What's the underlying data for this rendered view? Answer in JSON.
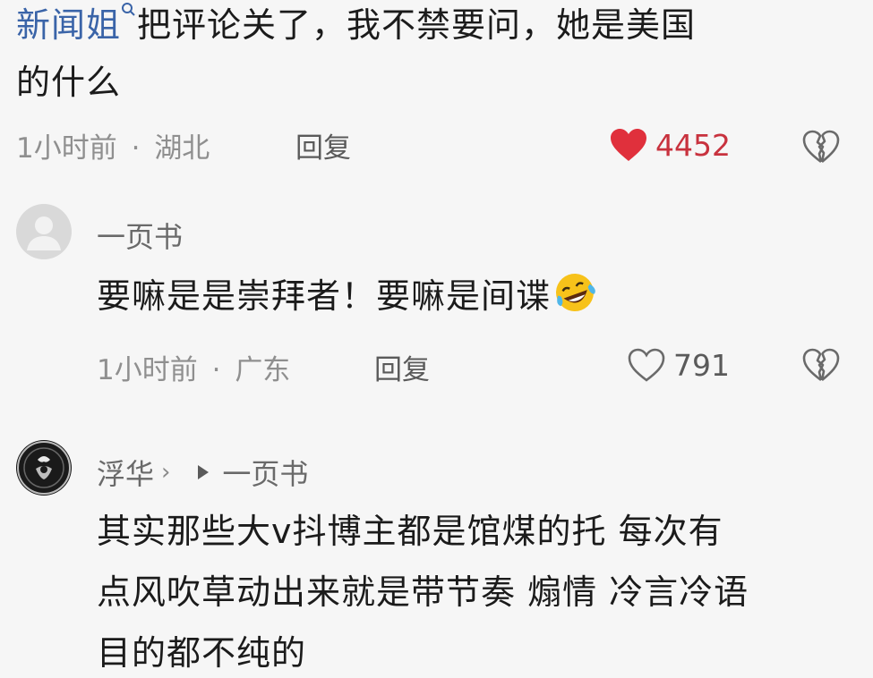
{
  "comment1": {
    "text_link": "新闻姐",
    "text_rest_line1": "把评论关了，我不禁要问，她是美国",
    "text_line2": "的什么",
    "time": "1小时前",
    "sep": "·",
    "location": "湖北",
    "reply_label": "回复",
    "likes": "4452"
  },
  "comment2": {
    "username": "一页书",
    "text": "要嘛是是崇拜者！要嘛是间谍",
    "time": "1小时前",
    "sep": "·",
    "location": "广东",
    "reply_label": "回复",
    "likes": "791"
  },
  "comment3": {
    "username": "浮华",
    "reply_to": "一页书",
    "line1": "其实那些大v抖博主都是馆煤的托 每次有",
    "line2": "点风吹草动出来就是带节奏 煽情 冷言冷语",
    "line3": "目的都不纯的"
  },
  "colors": {
    "like_red": "#e0303c",
    "link_blue": "#3a64a8",
    "background": "#f6f6f6"
  },
  "icons": {
    "heart_liked": "heart-filled-icon",
    "heart": "heart-outline-icon",
    "dislike": "broken-heart-icon",
    "emoji": "laughing-tears-emoji-icon"
  }
}
